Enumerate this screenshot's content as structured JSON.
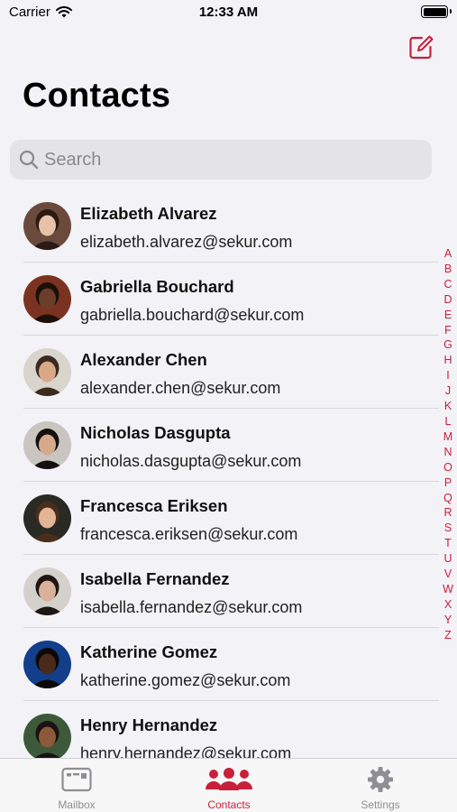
{
  "status_bar": {
    "carrier": "Carrier",
    "time": "12:33 AM",
    "battery_level": 1.0
  },
  "header": {
    "title": "Contacts",
    "compose_icon": "compose-icon"
  },
  "search": {
    "placeholder": "Search",
    "value": ""
  },
  "contacts": [
    {
      "name": "Elizabeth Alvarez",
      "email": "elizabeth.alvarez@sekur.com",
      "avatar_bg": "#6b4a3c",
      "skin": "#e8c2a8",
      "hair": "#2a1a14"
    },
    {
      "name": "Gabriella Bouchard",
      "email": "gabriella.bouchard@sekur.com",
      "avatar_bg": "#7a3320",
      "skin": "#6a3e28",
      "hair": "#1c0f08"
    },
    {
      "name": "Alexander Chen",
      "email": "alexander.chen@sekur.com",
      "avatar_bg": "#d9d4cc",
      "skin": "#d8a888",
      "hair": "#3a2a20"
    },
    {
      "name": "Nicholas Dasgupta",
      "email": "nicholas.dasgupta@sekur.com",
      "avatar_bg": "#c9c5c0",
      "skin": "#d6a98a",
      "hair": "#141010"
    },
    {
      "name": "Francesca Eriksen",
      "email": "francesca.eriksen@sekur.com",
      "avatar_bg": "#2a2a24",
      "skin": "#e2b596",
      "hair": "#4a2e1c"
    },
    {
      "name": "Isabella Fernandez",
      "email": "isabella.fernandez@sekur.com",
      "avatar_bg": "#d4d0cc",
      "skin": "#d9b09a",
      "hair": "#1e1612"
    },
    {
      "name": "Katherine Gomez",
      "email": "katherine.gomez@sekur.com",
      "avatar_bg": "#123e8a",
      "skin": "#4a2a1c",
      "hair": "#0c0808"
    },
    {
      "name": "Henry Hernandez",
      "email": "henry.hernandez@sekur.com",
      "avatar_bg": "#3c5a3a",
      "skin": "#8a5a3a",
      "hair": "#1a1210"
    }
  ],
  "index_letters": [
    "A",
    "B",
    "C",
    "D",
    "E",
    "F",
    "G",
    "H",
    "I",
    "J",
    "K",
    "L",
    "M",
    "N",
    "O",
    "P",
    "Q",
    "R",
    "S",
    "T",
    "U",
    "V",
    "W",
    "X",
    "Y",
    "Z"
  ],
  "tabs": [
    {
      "label": "Mailbox",
      "icon": "mailbox-icon",
      "active": false
    },
    {
      "label": "Contacts",
      "icon": "contacts-icon",
      "active": true
    },
    {
      "label": "Settings",
      "icon": "gear-icon",
      "active": false
    }
  ],
  "colors": {
    "accent": "#c8203a",
    "inactive_tab": "#8e8e93",
    "background": "#f2f2f7"
  }
}
